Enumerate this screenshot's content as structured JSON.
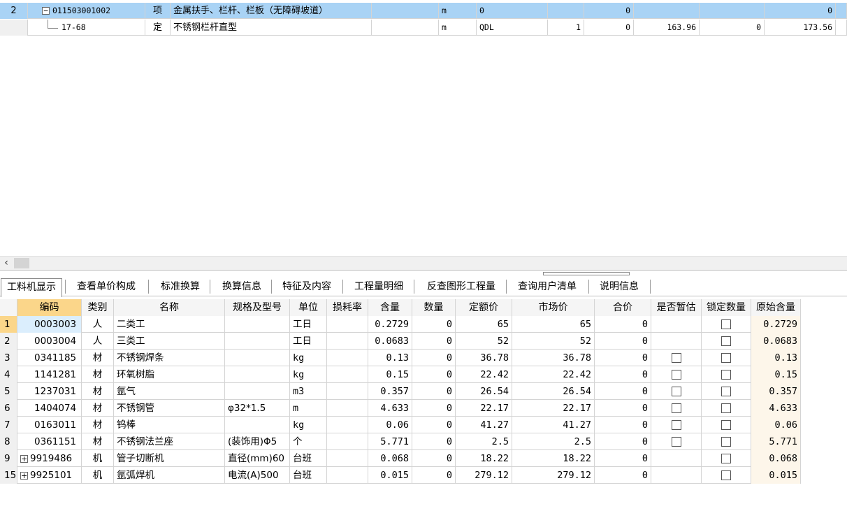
{
  "top_grid": {
    "rows": [
      {
        "index": "2",
        "toggle": "−",
        "code": "011503001002",
        "type": "项",
        "name": "金属扶手、栏杆、栏板（无障碍坡道）",
        "spec": "",
        "unit": "m",
        "expr": "0",
        "qty": "",
        "c1": "0",
        "c2": "",
        "c3": "",
        "c4": "0"
      },
      {
        "index": "",
        "toggle": "",
        "code": "17-68",
        "type": "定",
        "name": "不锈钢栏杆直型",
        "spec": "",
        "unit": "m",
        "expr": "QDL",
        "qty": "1",
        "c1": "0",
        "c2": "163.96",
        "c3": "0",
        "c4": "173.56"
      }
    ]
  },
  "scrollbar": {
    "left_arrow": "‹"
  },
  "tabs": [
    "工料机显示",
    "查看单价构成",
    "标准换算",
    "换算信息",
    "特征及内容",
    "工程量明细",
    "反查图形工程量",
    "查询用户清单",
    "说明信息"
  ],
  "bottom_grid": {
    "headers": [
      "编码",
      "类别",
      "名称",
      "规格及型号",
      "单位",
      "损耗率",
      "含量",
      "数量",
      "定额价",
      "市场价",
      "合价",
      "是否暂估",
      "锁定数量",
      "原始含量"
    ],
    "rows": [
      {
        "num": "1",
        "expand": "",
        "code": "0003003",
        "cat": "人",
        "name": "二类工",
        "spec": "",
        "unit": "工日",
        "loss": "",
        "content": "0.2729",
        "qty": "0",
        "quota": "65",
        "market": "65",
        "total": "0",
        "est": false,
        "lock": true,
        "orig": "0.2729"
      },
      {
        "num": "2",
        "expand": "",
        "code": "0003004",
        "cat": "人",
        "name": "三类工",
        "spec": "",
        "unit": "工日",
        "loss": "",
        "content": "0.0683",
        "qty": "0",
        "quota": "52",
        "market": "52",
        "total": "0",
        "est": false,
        "lock": true,
        "orig": "0.0683"
      },
      {
        "num": "3",
        "expand": "",
        "code": "0341185",
        "cat": "材",
        "name": "不锈钢焊条",
        "spec": "",
        "unit": "kg",
        "loss": "",
        "content": "0.13",
        "qty": "0",
        "quota": "36.78",
        "market": "36.78",
        "total": "0",
        "est": true,
        "lock": true,
        "orig": "0.13"
      },
      {
        "num": "4",
        "expand": "",
        "code": "1141281",
        "cat": "材",
        "name": "环氧树脂",
        "spec": "",
        "unit": "kg",
        "loss": "",
        "content": "0.15",
        "qty": "0",
        "quota": "22.42",
        "market": "22.42",
        "total": "0",
        "est": true,
        "lock": true,
        "orig": "0.15"
      },
      {
        "num": "5",
        "expand": "",
        "code": "1237031",
        "cat": "材",
        "name": "氩气",
        "spec": "",
        "unit": "m3",
        "loss": "",
        "content": "0.357",
        "qty": "0",
        "quota": "26.54",
        "market": "26.54",
        "total": "0",
        "est": true,
        "lock": true,
        "orig": "0.357"
      },
      {
        "num": "6",
        "expand": "",
        "code": "1404074",
        "cat": "材",
        "name": "不锈钢管",
        "spec": "φ32*1.5",
        "unit": "m",
        "loss": "",
        "content": "4.633",
        "qty": "0",
        "quota": "22.17",
        "market": "22.17",
        "total": "0",
        "est": true,
        "lock": true,
        "orig": "4.633"
      },
      {
        "num": "7",
        "expand": "",
        "code": "0163011",
        "cat": "材",
        "name": "钨棒",
        "spec": "",
        "unit": "kg",
        "loss": "",
        "content": "0.06",
        "qty": "0",
        "quota": "41.27",
        "market": "41.27",
        "total": "0",
        "est": true,
        "lock": true,
        "orig": "0.06"
      },
      {
        "num": "8",
        "expand": "",
        "code": "0361151",
        "cat": "材",
        "name": "不锈钢法兰座",
        "spec": "(装饰用)Φ5",
        "unit": "个",
        "loss": "",
        "content": "5.771",
        "qty": "0",
        "quota": "2.5",
        "market": "2.5",
        "total": "0",
        "est": true,
        "lock": true,
        "orig": "5.771"
      },
      {
        "num": "9",
        "expand": "+",
        "code": "9919486",
        "cat": "机",
        "name": "管子切断机",
        "spec": "直径(mm)60",
        "unit": "台班",
        "loss": "",
        "content": "0.068",
        "qty": "0",
        "quota": "18.22",
        "market": "18.22",
        "total": "0",
        "est": false,
        "lock": true,
        "orig": "0.068"
      },
      {
        "num": "15",
        "expand": "+",
        "code": "9925101",
        "cat": "机",
        "name": "氩弧焊机",
        "spec": "电流(A)500",
        "unit": "台班",
        "loss": "",
        "content": "0.015",
        "qty": "0",
        "quota": "279.12",
        "market": "279.12",
        "total": "0",
        "est": false,
        "lock": true,
        "orig": "0.015"
      }
    ]
  },
  "colors": {
    "selected_row": "#a9d3f5",
    "sorted_header": "#fbd68a",
    "selected_cell": "#dbeefd"
  }
}
